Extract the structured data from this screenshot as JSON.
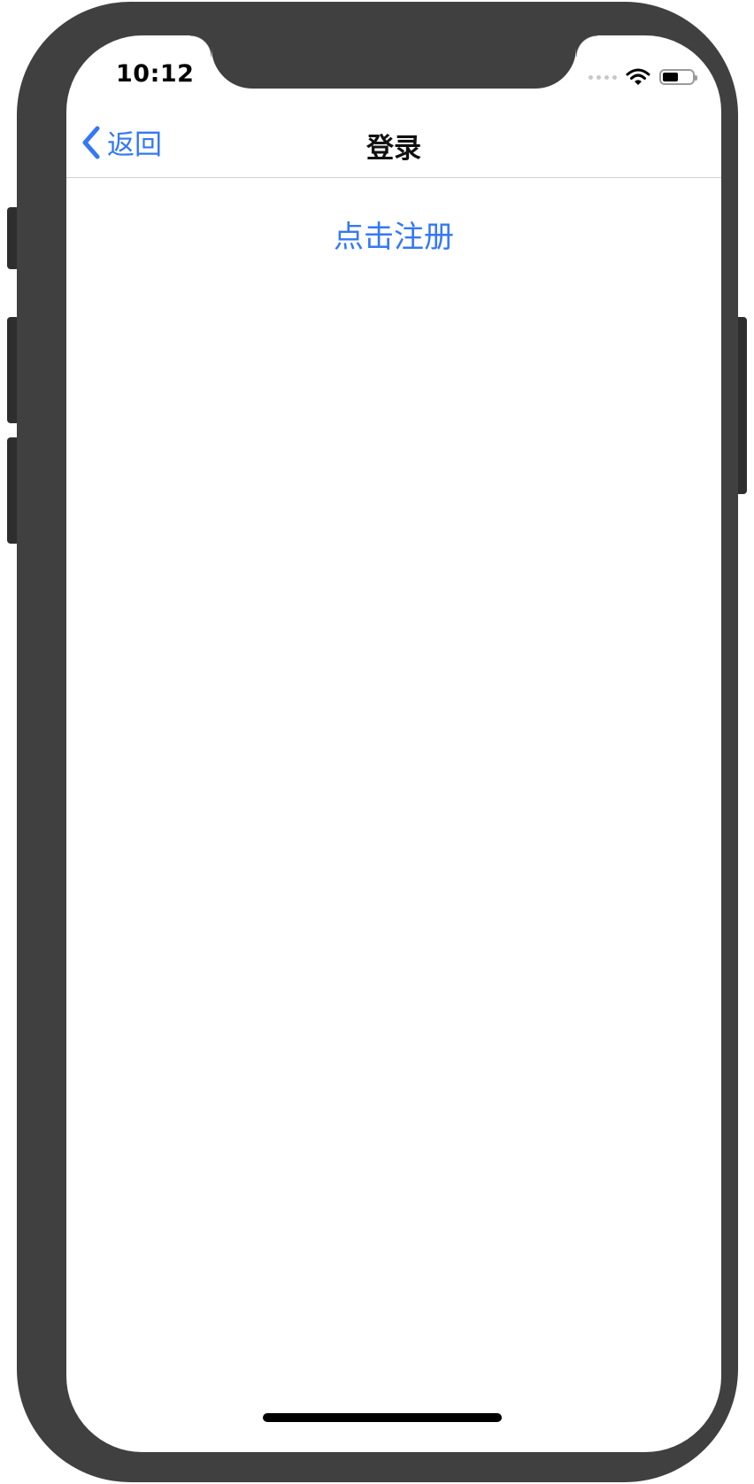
{
  "status_bar": {
    "time": "10:12",
    "icons": [
      "signal-icon",
      "wifi-icon",
      "battery-icon"
    ],
    "battery_level": 0.55
  },
  "nav_bar": {
    "back_label": "返回",
    "title": "登录"
  },
  "content": {
    "register_link": "点击注册"
  },
  "colors": {
    "accent": "#3478f6",
    "frame": "#404040",
    "background": "#ffffff"
  }
}
